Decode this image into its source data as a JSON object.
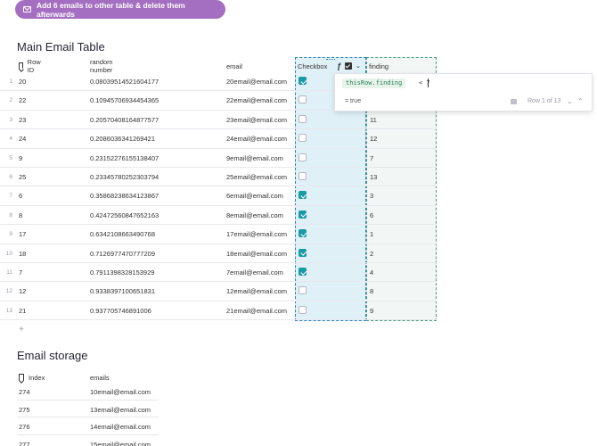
{
  "action_button": {
    "label": "Add 6 emails to other table & delete them afterwards",
    "icon": "mail-icon",
    "color": "#a46fc1"
  },
  "main_table": {
    "title": "Main Email Table",
    "columns": [
      "Row ID",
      "random number",
      "email",
      "Checkbox",
      "finding"
    ],
    "rows": [
      {
        "num": "1",
        "id": "20",
        "rand": "0.0803951452160417​7",
        "email": "20email@email.com",
        "checked": true,
        "finding": ""
      },
      {
        "num": "2",
        "id": "22",
        "rand": "0.10945706934454365",
        "email": "22email@email.com",
        "checked": false,
        "finding": ""
      },
      {
        "num": "3",
        "id": "23",
        "rand": "0.20570408164877577",
        "email": "23email@email.com",
        "checked": false,
        "finding": "11"
      },
      {
        "num": "4",
        "id": "24",
        "rand": "0.2086036341269421",
        "email": "24email@email.com",
        "checked": false,
        "finding": "12"
      },
      {
        "num": "5",
        "id": "9",
        "rand": "0.23152276155138407",
        "email": "9email@email.com",
        "checked": false,
        "finding": "7"
      },
      {
        "num": "6",
        "id": "25",
        "rand": "0.23345780252303794",
        "email": "25email@email.com",
        "checked": false,
        "finding": "13"
      },
      {
        "num": "7",
        "id": "6",
        "rand": "0.35868238634123867",
        "email": "6email@email.com",
        "checked": true,
        "finding": "3"
      },
      {
        "num": "8",
        "id": "8",
        "rand": "0.42472560847652163",
        "email": "8email@email.com",
        "checked": true,
        "finding": "6"
      },
      {
        "num": "9",
        "id": "17",
        "rand": "0.6342108663490768",
        "email": "17email@email.com",
        "checked": true,
        "finding": "1"
      },
      {
        "num": "10",
        "id": "18",
        "rand": "0.7126977470777209",
        "email": "18email@email.com",
        "checked": true,
        "finding": "2"
      },
      {
        "num": "11",
        "id": "7",
        "rand": "0.7911398328153929",
        "email": "7email@email.com",
        "checked": true,
        "finding": "4"
      },
      {
        "num": "12",
        "id": "12",
        "rand": "0.9338397100651831",
        "email": "12email@email.com",
        "checked": false,
        "finding": "8"
      },
      {
        "num": "13",
        "id": "21",
        "rand": "0.937705746891006",
        "email": "21email@email.com",
        "checked": false,
        "finding": "9"
      }
    ],
    "add_row": "+"
  },
  "formula_editor": {
    "column_icons": [
      "formula-icon",
      "checkbox-icon",
      "chevron-down-icon"
    ],
    "code_token": "thisRow.finding",
    "code_rest": "< 7",
    "result": "= true",
    "row_indicator": "Row 1 of 13"
  },
  "email_storage": {
    "title": "Email storage",
    "columns": [
      "Index",
      "emails"
    ],
    "rows": [
      {
        "index": "274",
        "email": "10email@email.com"
      },
      {
        "index": "275",
        "email": "13email@email.com"
      },
      {
        "index": "276",
        "email": "14email@email.com"
      },
      {
        "index": "277",
        "email": "15email@email.com"
      }
    ]
  }
}
